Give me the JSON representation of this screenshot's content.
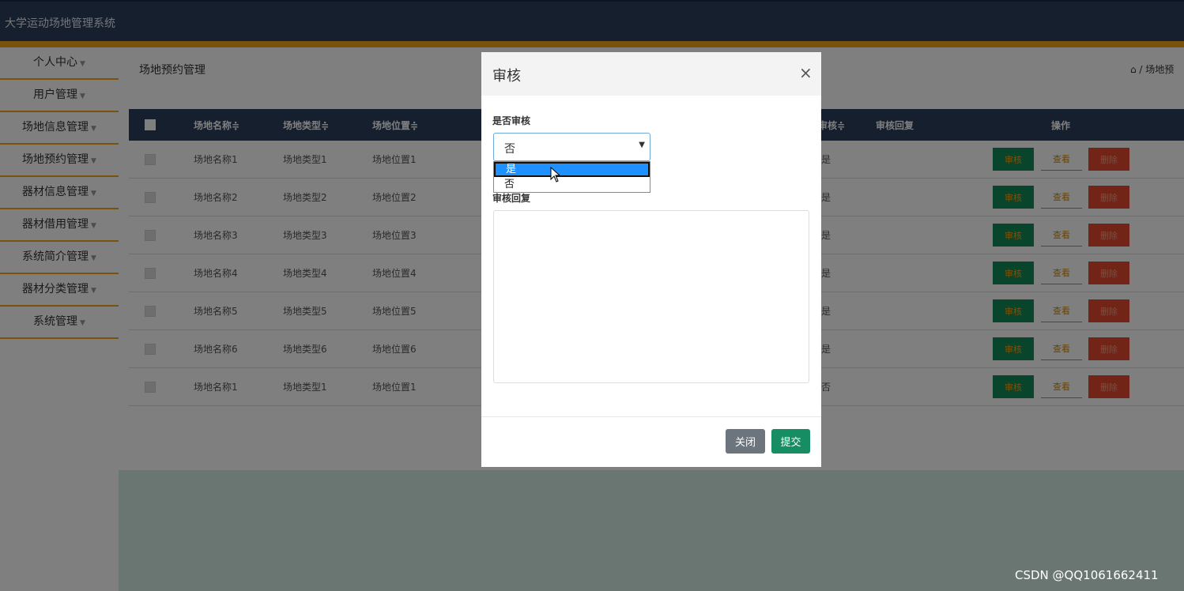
{
  "app": {
    "title": "大学运动场地管理系统"
  },
  "sidebar": {
    "items": [
      {
        "label": "个人中心"
      },
      {
        "label": "用户管理"
      },
      {
        "label": "场地信息管理"
      },
      {
        "label": "场地预约管理"
      },
      {
        "label": "器材信息管理"
      },
      {
        "label": "器材借用管理"
      },
      {
        "label": "系统简介管理"
      },
      {
        "label": "器材分类管理"
      },
      {
        "label": "系统管理"
      }
    ],
    "caret": "▼"
  },
  "page": {
    "title": "场地预约管理",
    "breadcrumb": "⌂ / 场地预"
  },
  "table": {
    "headers": {
      "name": "场地名称≑",
      "type": "场地类型≑",
      "location": "场地位置≑",
      "audit": "审核≑",
      "reply": "审核回复",
      "actions": "操作"
    },
    "rows": [
      {
        "name": "场地名称1",
        "type": "场地类型1",
        "location": "场地位置1",
        "audit": "是"
      },
      {
        "name": "场地名称2",
        "type": "场地类型2",
        "location": "场地位置2",
        "audit": "是"
      },
      {
        "name": "场地名称3",
        "type": "场地类型3",
        "location": "场地位置3",
        "audit": "是"
      },
      {
        "name": "场地名称4",
        "type": "场地类型4",
        "location": "场地位置4",
        "audit": "是"
      },
      {
        "name": "场地名称5",
        "type": "场地类型5",
        "location": "场地位置5",
        "audit": "是"
      },
      {
        "name": "场地名称6",
        "type": "场地类型6",
        "location": "场地位置6",
        "audit": "是"
      },
      {
        "name": "场地名称1",
        "type": "场地类型1",
        "location": "场地位置1",
        "audit": "否"
      }
    ],
    "buttons": {
      "audit": "审核",
      "view": "查看",
      "delete": "删除"
    }
  },
  "modal": {
    "title": "审核",
    "close_icon": "×",
    "audit_label": "是否审核",
    "audit_value": "否",
    "audit_options": [
      "是",
      "否"
    ],
    "highlighted_option": "是",
    "reply_label": "审核回复",
    "reply_value": "",
    "close_button": "关闭",
    "submit_button": "提交"
  },
  "watermark": "CSDN @QQ1061662411",
  "colors": {
    "header": "#2c3e5c",
    "accent": "#f2a516",
    "audit_button": "#138a5a",
    "delete_button": "#e54b2d",
    "submit_button": "#168d62",
    "close_button": "#6c757d"
  }
}
